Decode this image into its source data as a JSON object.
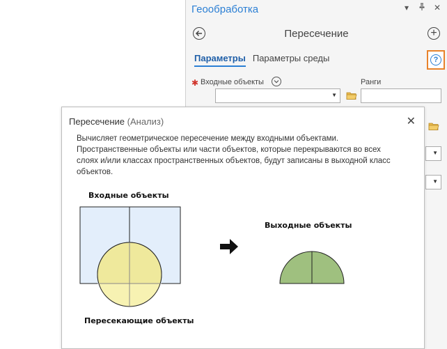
{
  "pane": {
    "title": "Геообработка",
    "tool_name": "Пересечение",
    "tabs": [
      {
        "label": "Параметры",
        "active": true
      },
      {
        "label": "Параметры среды",
        "active": false
      }
    ],
    "help_icon": "question-circle-icon",
    "params": {
      "input_label": "Входные объекты",
      "ranks_label": "Ранги",
      "input_value": "",
      "ranks_value": ""
    },
    "colors": {
      "title_blue": "#2b7fd4",
      "help_highlight": "#e8822a",
      "required": "#d0342c"
    }
  },
  "popup": {
    "title": "Пересечение",
    "category": "(Анализ)",
    "description": "Вычисляет геометрическое пересечение между входными объектами. Пространственные объекты или части объектов, которые перекрываются во всех слоях и/или классах пространственных объектов, будут записаны в выходной класс объектов.",
    "diagram": {
      "input_label": "Входные объекты",
      "output_label": "Выходные объекты",
      "intersecting_label": "Пересекающие объекты",
      "colors": {
        "input_fill": "#e3eefb",
        "circle_fill": "#f7f2b2",
        "overlap_fill": "#efe99c",
        "output_fill": "#9fc07f"
      }
    }
  }
}
